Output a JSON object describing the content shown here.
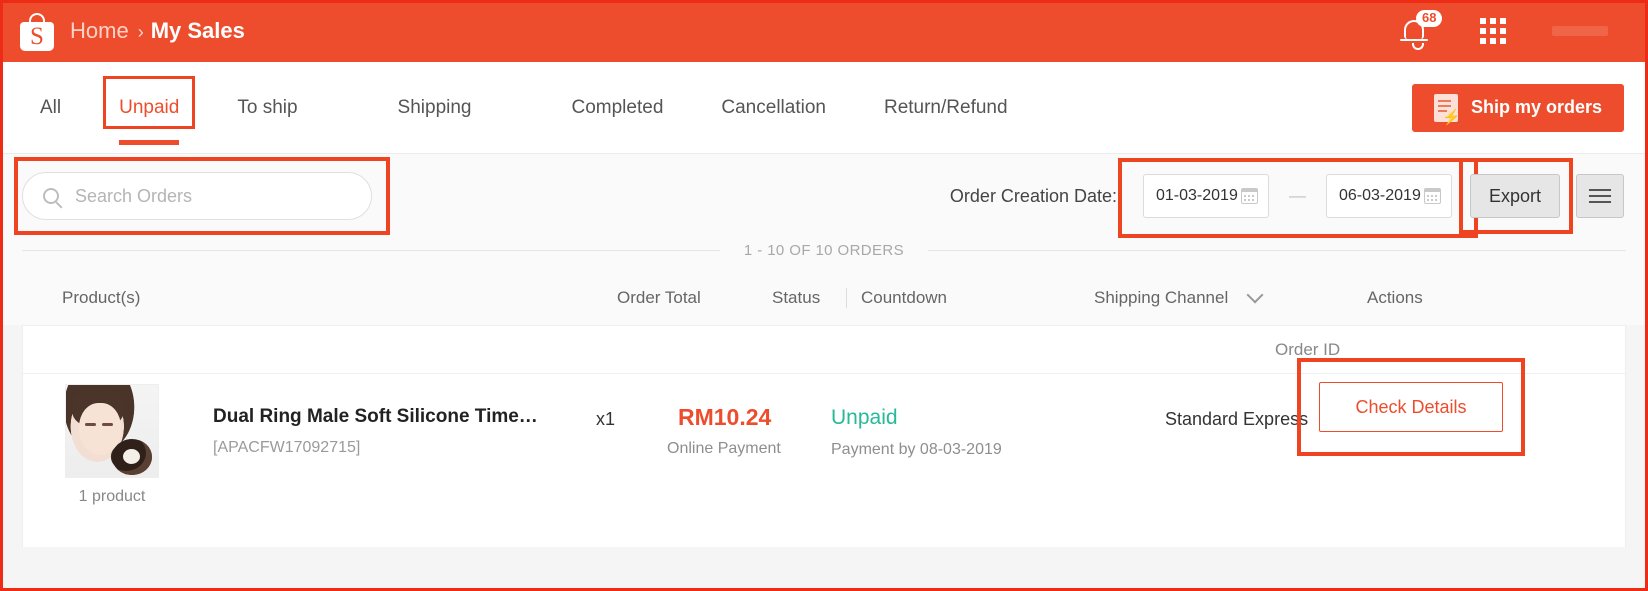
{
  "header": {
    "logo_letter": "S",
    "breadcrumb_home": "Home",
    "breadcrumb_sep": "›",
    "breadcrumb_current": "My Sales",
    "notification_count": "68",
    "brand_color": "#ee4d2d"
  },
  "tabs": [
    {
      "label": "All",
      "active": false
    },
    {
      "label": "Unpaid",
      "active": true
    },
    {
      "label": "To ship",
      "active": false
    },
    {
      "label": "Shipping",
      "active": false
    },
    {
      "label": "Completed",
      "active": false
    },
    {
      "label": "Cancellation",
      "active": false
    },
    {
      "label": "Return/Refund",
      "active": false
    }
  ],
  "ship_button": {
    "label": "Ship my orders"
  },
  "search": {
    "placeholder": "Search Orders",
    "value": ""
  },
  "date_filter": {
    "label": "Order Creation Date:",
    "from": "01-03-2019",
    "separator": "—",
    "to": "06-03-2019"
  },
  "export_button": {
    "label": "Export"
  },
  "count_text": "1 - 10 OF 10 ORDERS",
  "table": {
    "headers": {
      "products": "Product(s)",
      "order_total": "Order Total",
      "status": "Status",
      "countdown": "Countdown",
      "shipping_channel": "Shipping Channel",
      "actions": "Actions",
      "order_id": "Order ID"
    },
    "rows": [
      {
        "thumb_label": "1 product",
        "title": "Dual Ring Male Soft Silicone Time…",
        "sku": "[APACFW17092715]",
        "quantity": "x1",
        "price": "RM10.24",
        "payment_method": "Online Payment",
        "status": "Unpaid",
        "payment_due": "Payment by 08-03-2019",
        "shipping_channel": "Standard Express",
        "action_label": "Check Details"
      }
    ]
  },
  "status_colors": {
    "unpaid": "#26b99a",
    "price": "#ee4d2d"
  }
}
